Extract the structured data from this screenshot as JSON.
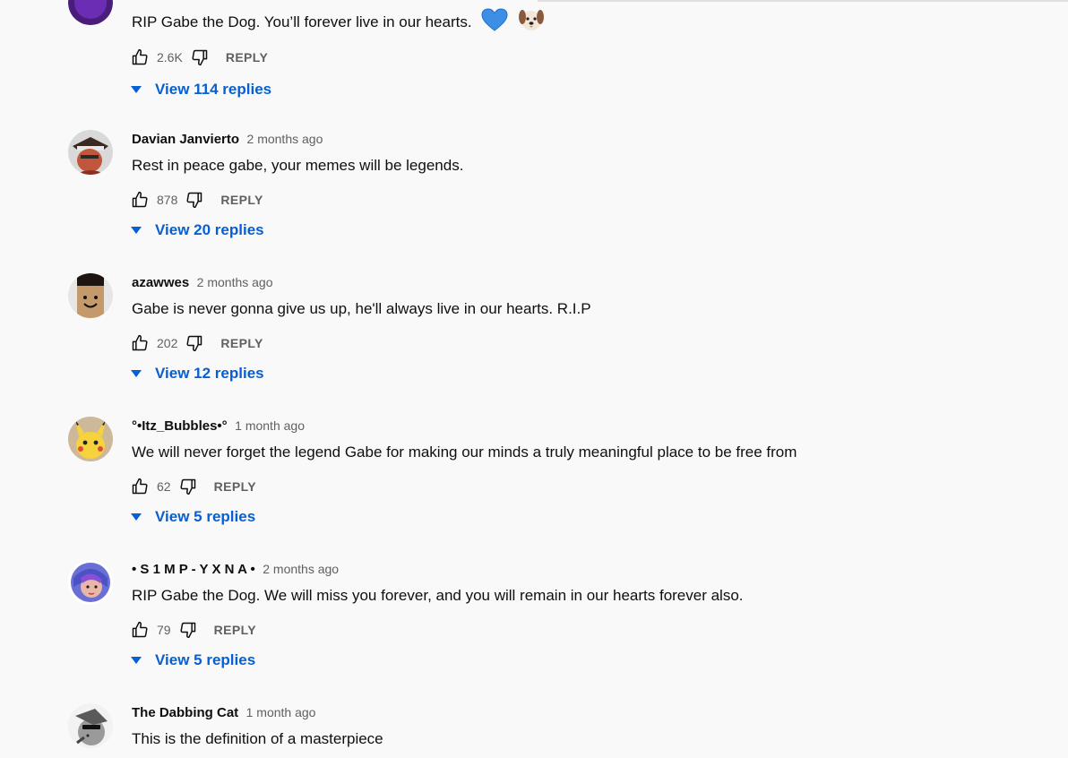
{
  "comments": [
    {
      "author": "",
      "time": "",
      "text": "RIP Gabe the Dog. You’ll forever live in our hearts.",
      "likes": "2.6K",
      "reply_label": "REPLY",
      "view_replies": "View 114 replies",
      "emojis": [
        "blue-heart-icon",
        "dog-face-icon"
      ]
    },
    {
      "author": "Davian Janvierto",
      "time": "2 months ago",
      "text": "Rest in peace gabe, your memes will be legends.",
      "likes": "878",
      "reply_label": "REPLY",
      "view_replies": "View 20 replies"
    },
    {
      "author": "azawwes",
      "time": "2 months ago",
      "text": "Gabe is never gonna give us up, he'll always live in our hearts. R.I.P",
      "likes": "202",
      "reply_label": "REPLY",
      "view_replies": "View 12 replies"
    },
    {
      "author": "°•Itz_Bubbles•°",
      "time": "1 month ago",
      "text": "We will never forget the legend Gabe for making our minds a truly meaningful place to be free from",
      "likes": "62",
      "reply_label": "REPLY",
      "view_replies": "View 5 replies"
    },
    {
      "author": "• S 1 M P - Y X N A •",
      "time": "2 months ago",
      "text": "RIP Gabe the Dog. We will miss you forever, and you will remain in our hearts forever also.",
      "likes": "79",
      "reply_label": "REPLY",
      "view_replies": "View 5 replies"
    },
    {
      "author": "The Dabbing Cat",
      "time": "1 month ago",
      "text": "This is the definition of a masterpiece"
    }
  ],
  "colors": {
    "background": "#f9f9f9",
    "link_blue": "#065fd4",
    "secondary_text": "#606060",
    "primary_text": "#0f0f0f"
  },
  "icons": {
    "like": "thumbs-up-icon",
    "dislike": "thumbs-down-icon",
    "expand": "caret-down-icon"
  }
}
